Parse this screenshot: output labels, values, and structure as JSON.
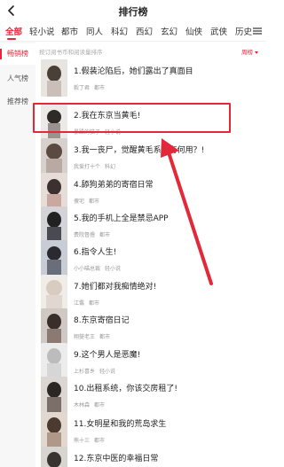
{
  "header": {
    "title": "排行榜"
  },
  "categories": [
    "全部",
    "轻小说",
    "都市",
    "同人",
    "科幻",
    "西幻",
    "玄幻",
    "仙侠",
    "武侠",
    "历史"
  ],
  "active_category": "全部",
  "sidebar": {
    "items": [
      {
        "label": "畅销榜",
        "active": true
      },
      {
        "label": "人气榜",
        "active": false
      },
      {
        "label": "推荐榜",
        "active": false
      }
    ]
  },
  "list_header": {
    "notice": "按订阅书币和阅读量排序",
    "sort_label": "周榜"
  },
  "books": [
    {
      "title": "1.假装沦陷后，她们露出了真面目",
      "author": "毅丁君",
      "genre": "都市"
    },
    {
      "title": "2.我在东京当黄毛!",
      "author": "暴躁的猫子",
      "genre": "轻小说"
    },
    {
      "title": "3.我一丧尸，觉醒黄毛系统有何用？!",
      "author": "我爱打十个",
      "genre": "科幻"
    },
    {
      "title": "4.舔狗弟弟的寄宿日常",
      "author": "傻宅",
      "genre": "都市"
    },
    {
      "title": "5.我的手机上全是禁忌APP",
      "author": "费院督撸",
      "genre": "都市"
    },
    {
      "title": "6.指令人生!",
      "author": "小小喵总裁",
      "genre": "轻小说"
    },
    {
      "title": "7.她们都对我痴情绝对!",
      "author": "江翥",
      "genre": "都市"
    },
    {
      "title": "8.东京寄宿日记",
      "author": "翔燮老王",
      "genre": "都市"
    },
    {
      "title": "9.这个男人是恶魔!",
      "author": "上杉喜乡",
      "genre": "轻小说"
    },
    {
      "title": "10.出租系统，你该交房租了!",
      "author": "木林森",
      "genre": "都市"
    },
    {
      "title": "11.女明星和我的荒岛求生",
      "author": "熊十三",
      "genre": "都市"
    },
    {
      "title": "12.东京中医的幸福日常",
      "author": "",
      "genre": ""
    }
  ],
  "icons": {
    "back": "chevron-left-icon",
    "menu": "list-menu-icon"
  },
  "colors": {
    "accent": "#e2293a",
    "sidebar_bg": "#f7f7f7",
    "meta_text": "#999999"
  },
  "annotation": {
    "highlighted_rank": 2
  }
}
